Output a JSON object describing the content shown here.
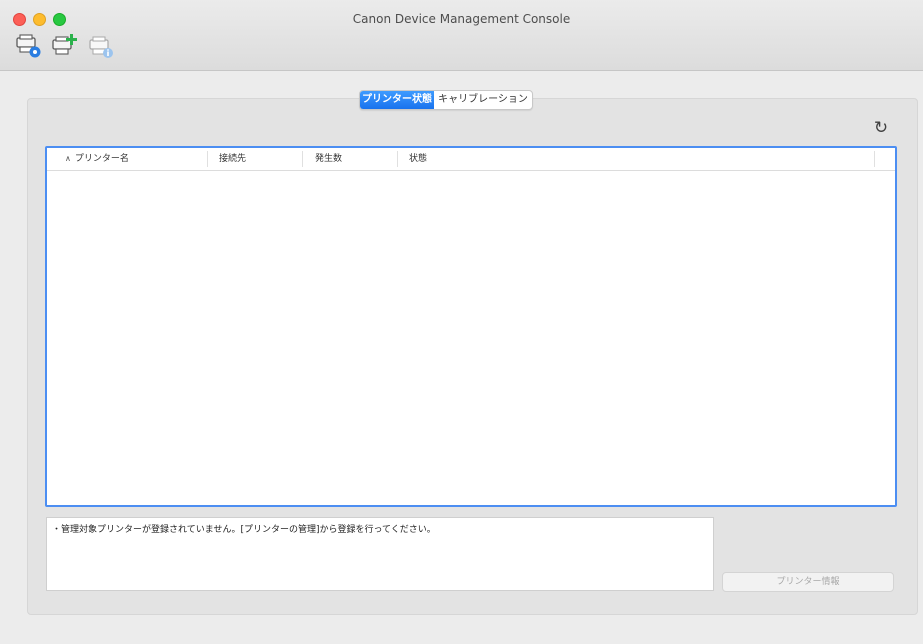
{
  "window": {
    "title": "Canon Device Management Console"
  },
  "toolbar": {
    "buttons": [
      {
        "icon": "printer-settings-icon"
      },
      {
        "icon": "printer-add-icon"
      },
      {
        "icon": "printer-info-icon"
      }
    ]
  },
  "tabs": [
    {
      "label": "プリンター状態",
      "active": true
    },
    {
      "label": "キャリブレーション",
      "active": false
    }
  ],
  "refresh": {
    "icon": "refresh-icon",
    "glyph": "↻"
  },
  "table": {
    "columns": [
      {
        "label": "プリンター名",
        "sorted": "ascending"
      },
      {
        "label": "接続先"
      },
      {
        "label": "発生数"
      },
      {
        "label": "状態"
      }
    ],
    "rows": []
  },
  "message": {
    "text": "・管理対象プリンターが登録されていません。[プリンターの管理]から登録を行ってください。"
  },
  "printer_info_button": {
    "label": "プリンター情報",
    "enabled": false
  },
  "colors": {
    "accent": "#1872ee",
    "selection_border": "#4c8ef2",
    "add_green": "#2bb24c",
    "info_blue": "#2a7de1"
  }
}
